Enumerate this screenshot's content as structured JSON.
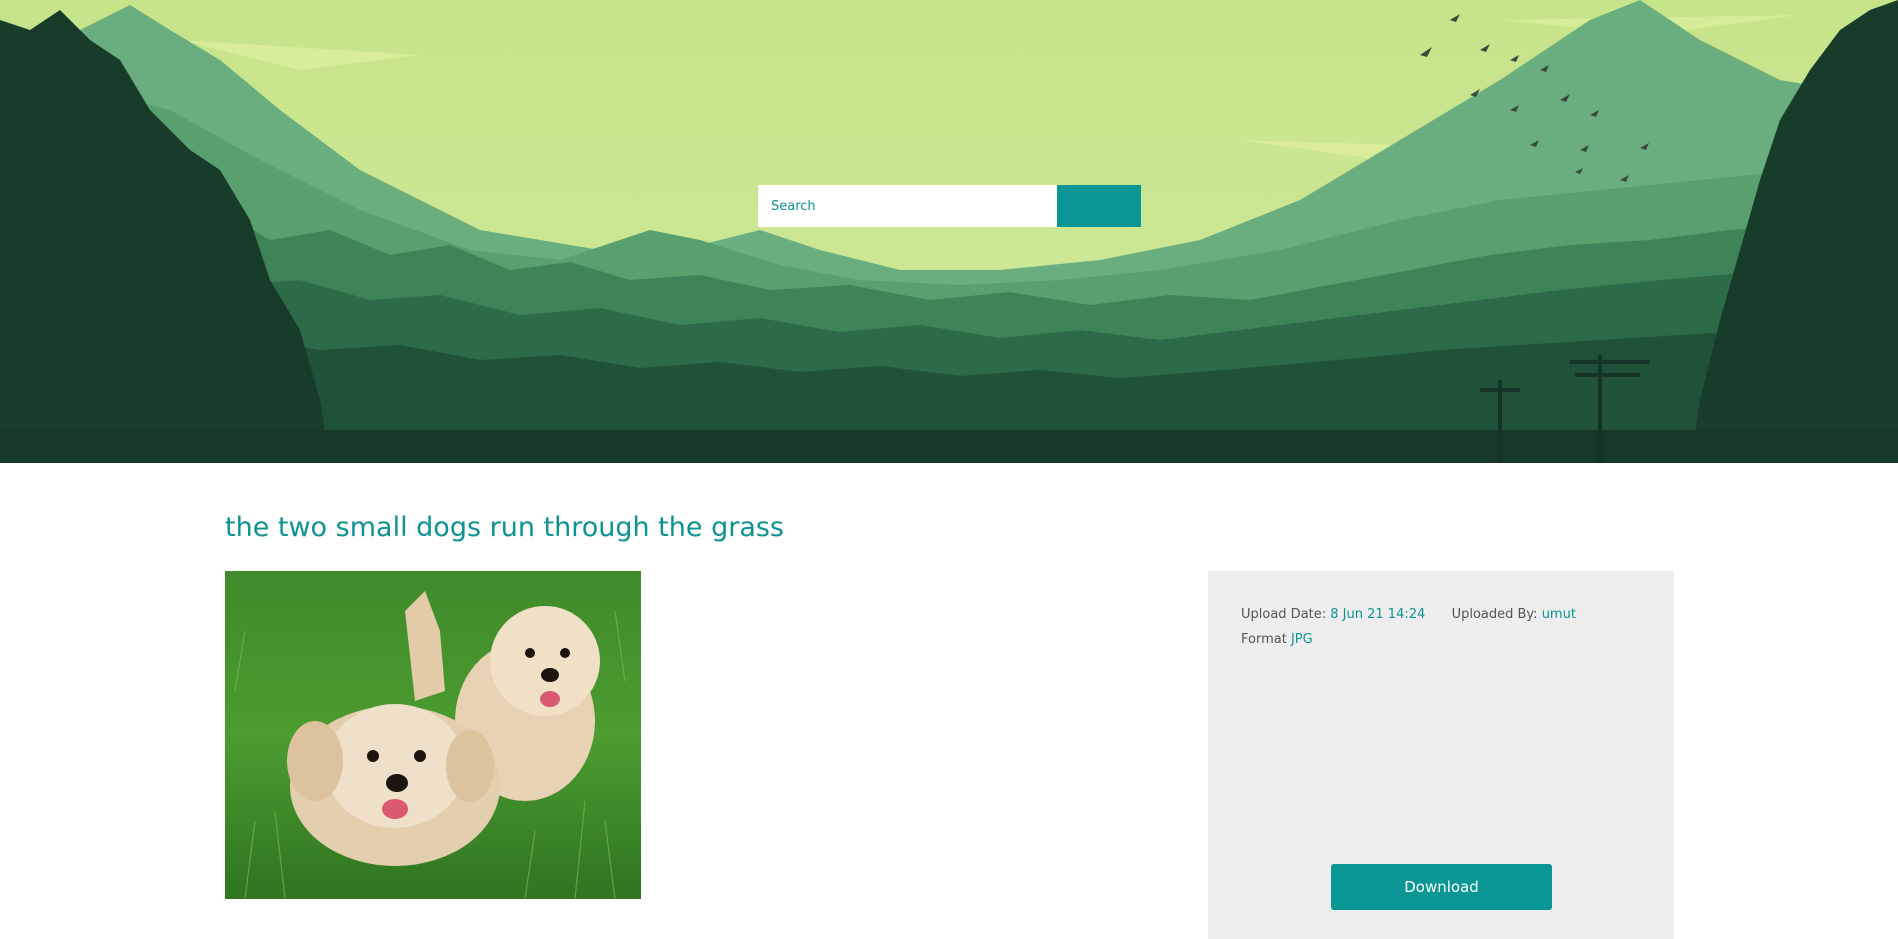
{
  "search": {
    "placeholder": "Search",
    "button_icon": "search-icon"
  },
  "image_detail": {
    "title": "the two small dogs run through the grass",
    "upload_date_label": "Upload Date:",
    "upload_date_value": "8 Jun 21 14:24",
    "uploaded_by_label": "Uploaded By:",
    "uploaded_by_value": "umut",
    "format_label": "Format",
    "format_value": "JPG",
    "download_label": "Download"
  },
  "colors": {
    "accent": "#0b9696",
    "sky": "#cbe68f",
    "panel": "#eeeeee"
  }
}
